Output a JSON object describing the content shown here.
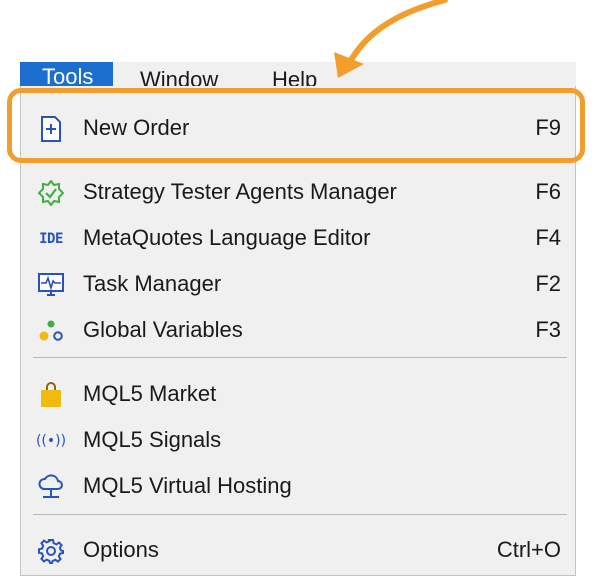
{
  "menubar": {
    "items": [
      {
        "label": "Tools",
        "active": true
      },
      {
        "label": "Window",
        "active": false
      },
      {
        "label": "Help",
        "active": false
      }
    ]
  },
  "menu": {
    "items": [
      {
        "label": "New Order",
        "shortcut": "F9",
        "icon": "new-order-icon"
      },
      {
        "label": "Strategy Tester Agents Manager",
        "shortcut": "F6",
        "icon": "agents-manager-icon"
      },
      {
        "label": "MetaQuotes Language Editor",
        "shortcut": "F4",
        "icon": "ide-icon",
        "icon_text": "IDE"
      },
      {
        "label": "Task Manager",
        "shortcut": "F2",
        "icon": "task-manager-icon"
      },
      {
        "label": "Global Variables",
        "shortcut": "F3",
        "icon": "global-variables-icon"
      },
      {
        "label": "MQL5 Market",
        "shortcut": "",
        "icon": "market-bag-icon"
      },
      {
        "label": "MQL5 Signals",
        "shortcut": "",
        "icon": "signals-icon",
        "icon_text": "((•))"
      },
      {
        "label": "MQL5 Virtual Hosting",
        "shortcut": "",
        "icon": "cloud-hosting-icon"
      },
      {
        "label": "Options",
        "shortcut": "Ctrl+O",
        "icon": "gear-icon"
      }
    ]
  },
  "colors": {
    "accent_highlight": "#f29e2e",
    "menubar_active": "#1c6fce",
    "icon_blue": "#2a52be",
    "icon_green": "#3cb043",
    "icon_yellow": "#f2b90f"
  }
}
